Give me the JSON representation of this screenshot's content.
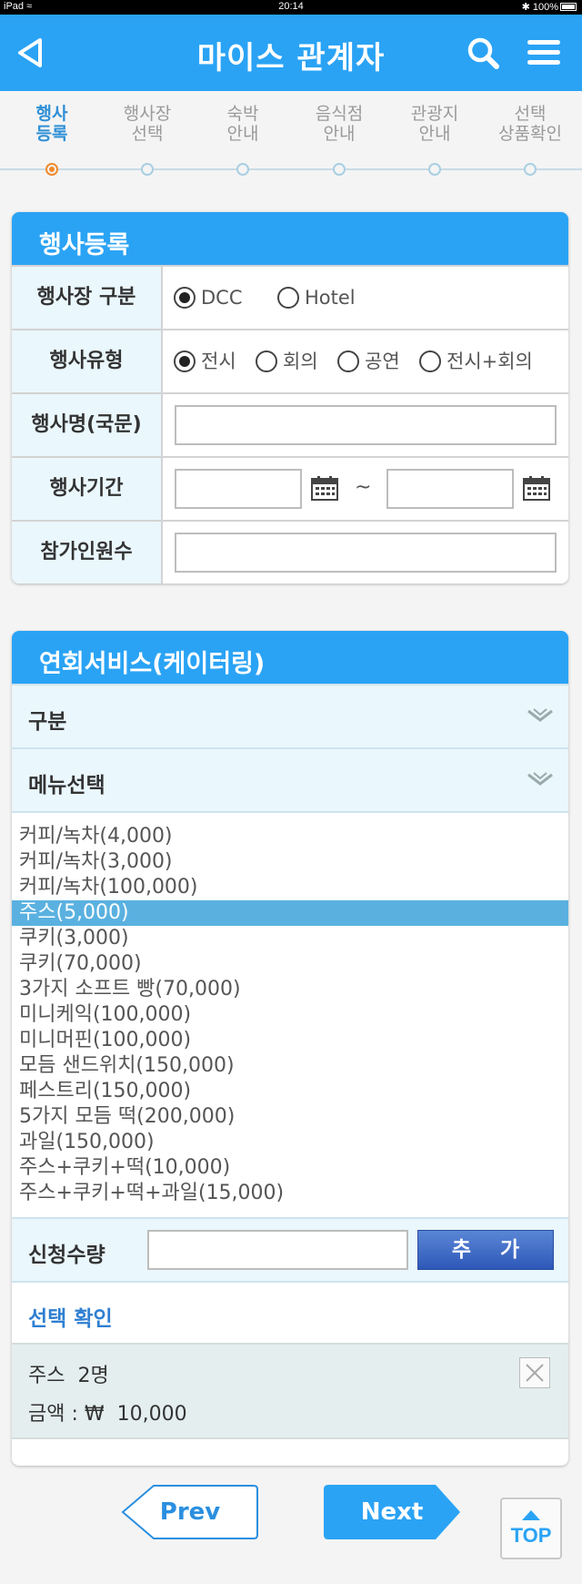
{
  "status_bar": {
    "device": "iPad",
    "time": "20:14",
    "battery": "100%"
  },
  "header": {
    "title": "마이스 관계자"
  },
  "steps": [
    {
      "line1": "행사",
      "line2": "등록",
      "active": true
    },
    {
      "line1": "행사장",
      "line2": "선택",
      "active": false
    },
    {
      "line1": "숙박",
      "line2": "안내",
      "active": false
    },
    {
      "line1": "음식점",
      "line2": "안내",
      "active": false
    },
    {
      "line1": "관광지",
      "line2": "안내",
      "active": false
    },
    {
      "line1": "선택",
      "line2": "상품확인",
      "active": false
    }
  ],
  "event_form": {
    "title": "행사등록",
    "venue_type": {
      "label": "행사장 구분",
      "options": [
        "DCC",
        "Hotel"
      ],
      "selected": "DCC"
    },
    "event_type": {
      "label": "행사유형",
      "options": [
        "전시",
        "회의",
        "공연",
        "전시+회의"
      ],
      "selected": "전시"
    },
    "event_name": {
      "label": "행사명(국문)",
      "value": ""
    },
    "event_period": {
      "label": "행사기간",
      "start": "",
      "end": "",
      "separator": "~"
    },
    "participants": {
      "label": "참가인원수",
      "value": ""
    }
  },
  "catering": {
    "title": "연회서비스(케이터링)",
    "category_label": "구분",
    "menu_label": "메뉴선택",
    "menu_options": [
      "커피/녹차(4,000)",
      "커피/녹차(3,000)",
      "커피/녹차(100,000)",
      "주스(5,000)",
      "쿠키(3,000)",
      "쿠키(70,000)",
      "3가지 소프트 빵(70,000)",
      "미니케익(100,000)",
      "미니머핀(100,000)",
      "모듬 샌드위치(150,000)",
      "페스트리(150,000)",
      "5가지 모듬 떡(200,000)",
      "과일(150,000)",
      "주스+쿠키+떡(10,000)",
      "주스+쿠키+떡+과일(15,000)"
    ],
    "selected_option_index": 3,
    "quantity_label": "신청수량",
    "quantity_value": "",
    "add_button": "추 가",
    "confirm_title": "선택 확인",
    "selected_item": {
      "name": "주스",
      "count": "2명",
      "amount_label": "금액 :",
      "currency": "₩",
      "amount": "10,000"
    }
  },
  "nav": {
    "prev": "Prev",
    "next": "Next",
    "top": "TOP"
  },
  "colors": {
    "header_blue": "#2aa3f5",
    "active_step": "#2f8fd6",
    "active_dot": "#f08a2c",
    "selected_option": "#5ab1e0"
  }
}
